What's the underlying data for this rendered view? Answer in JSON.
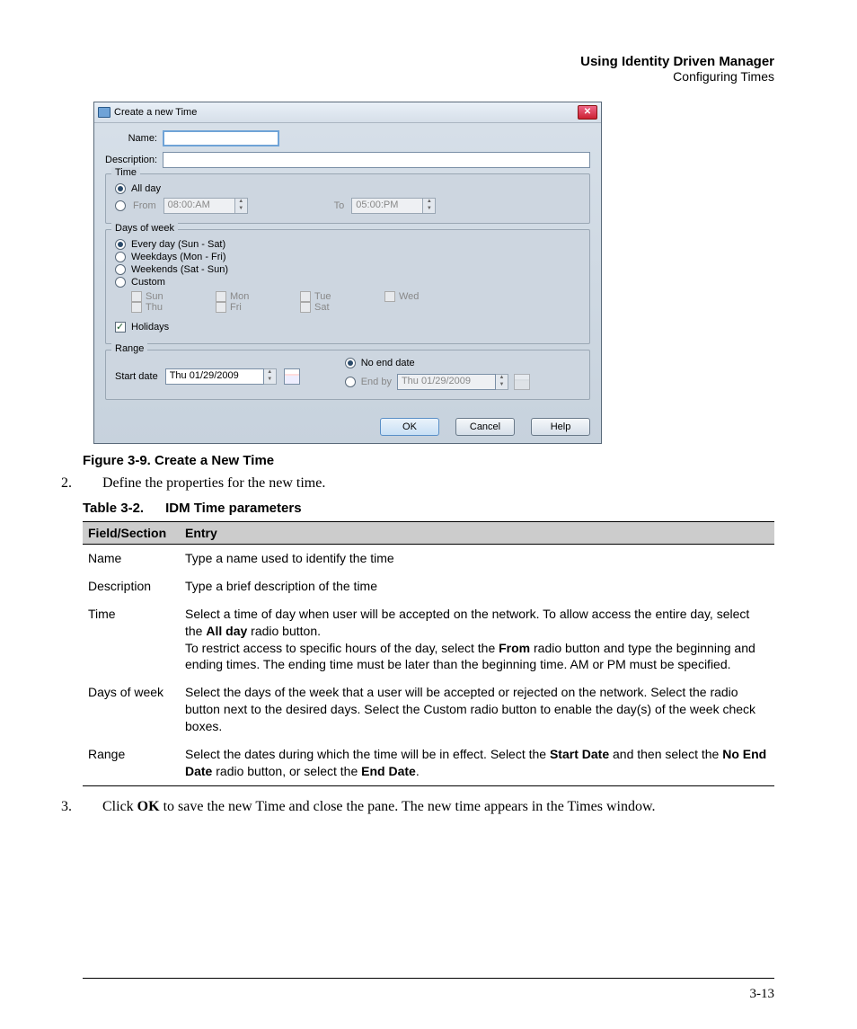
{
  "header": {
    "title": "Using Identity Driven Manager",
    "subtitle": "Configuring Times"
  },
  "dialog": {
    "title": "Create a new Time",
    "name_label": "Name:",
    "name_value": "",
    "desc_label": "Description:",
    "desc_value": "",
    "time_legend": "Time",
    "allday_label": "All day",
    "from_label": "From",
    "from_value": "08:00:AM",
    "to_label": "To",
    "to_value": "05:00:PM",
    "dow_legend": "Days of week",
    "dow_every": "Every day (Sun - Sat)",
    "dow_weekdays": "Weekdays (Mon - Fri)",
    "dow_weekends": "Weekends (Sat - Sun)",
    "dow_custom": "Custom",
    "days": {
      "sun": "Sun",
      "mon": "Mon",
      "tue": "Tue",
      "wed": "Wed",
      "thu": "Thu",
      "fri": "Fri",
      "sat": "Sat"
    },
    "holidays_label": "Holidays",
    "range_legend": "Range",
    "start_date_label": "Start date",
    "start_date_value": "Thu  01/29/2009",
    "no_end_label": "No end date",
    "end_by_label": "End by",
    "end_by_value": "Thu  01/29/2009",
    "ok": "OK",
    "cancel": "Cancel",
    "help": "Help"
  },
  "figure_caption": "Figure 3-9. Create a New Time",
  "step2": {
    "num": "2.",
    "text": "Define the properties for the new time."
  },
  "table_caption": {
    "label": "Table 3-2.",
    "title": "IDM Time parameters"
  },
  "table": {
    "head": {
      "c1": "Field/Section",
      "c2": "Entry"
    },
    "rows": [
      {
        "field": "Name",
        "entry_plain": "Type a name used to identify the time"
      },
      {
        "field": "Description",
        "entry_plain": "Type a brief description of the time"
      },
      {
        "field": "Time",
        "entry_html": "Select a time of day when user will be accepted on the network. To allow access the entire day, select the <b>All day</b> radio button.<br>To restrict access to specific hours of the day, select the <b>From</b> radio button and type the beginning and ending times. The ending time must be later than the beginning time. AM or PM must be specified."
      },
      {
        "field": "Days of week",
        "entry_plain": "Select the days of the week that a user will be accepted or rejected on the network. Select the radio button next to the desired days. Select the Custom radio button to enable the day(s) of the week check boxes."
      },
      {
        "field": "Range",
        "entry_html": "Select the dates during which the time will be in effect. Select the <b>Start Date</b> and then select the <b>No End Date</b> radio button, or select the <b>End Date</b>."
      }
    ]
  },
  "step3": {
    "num": "3.",
    "html": "Click <b>OK</b> to save the new Time and close the pane. The new time appears in the Times window."
  },
  "page_number": "3-13"
}
